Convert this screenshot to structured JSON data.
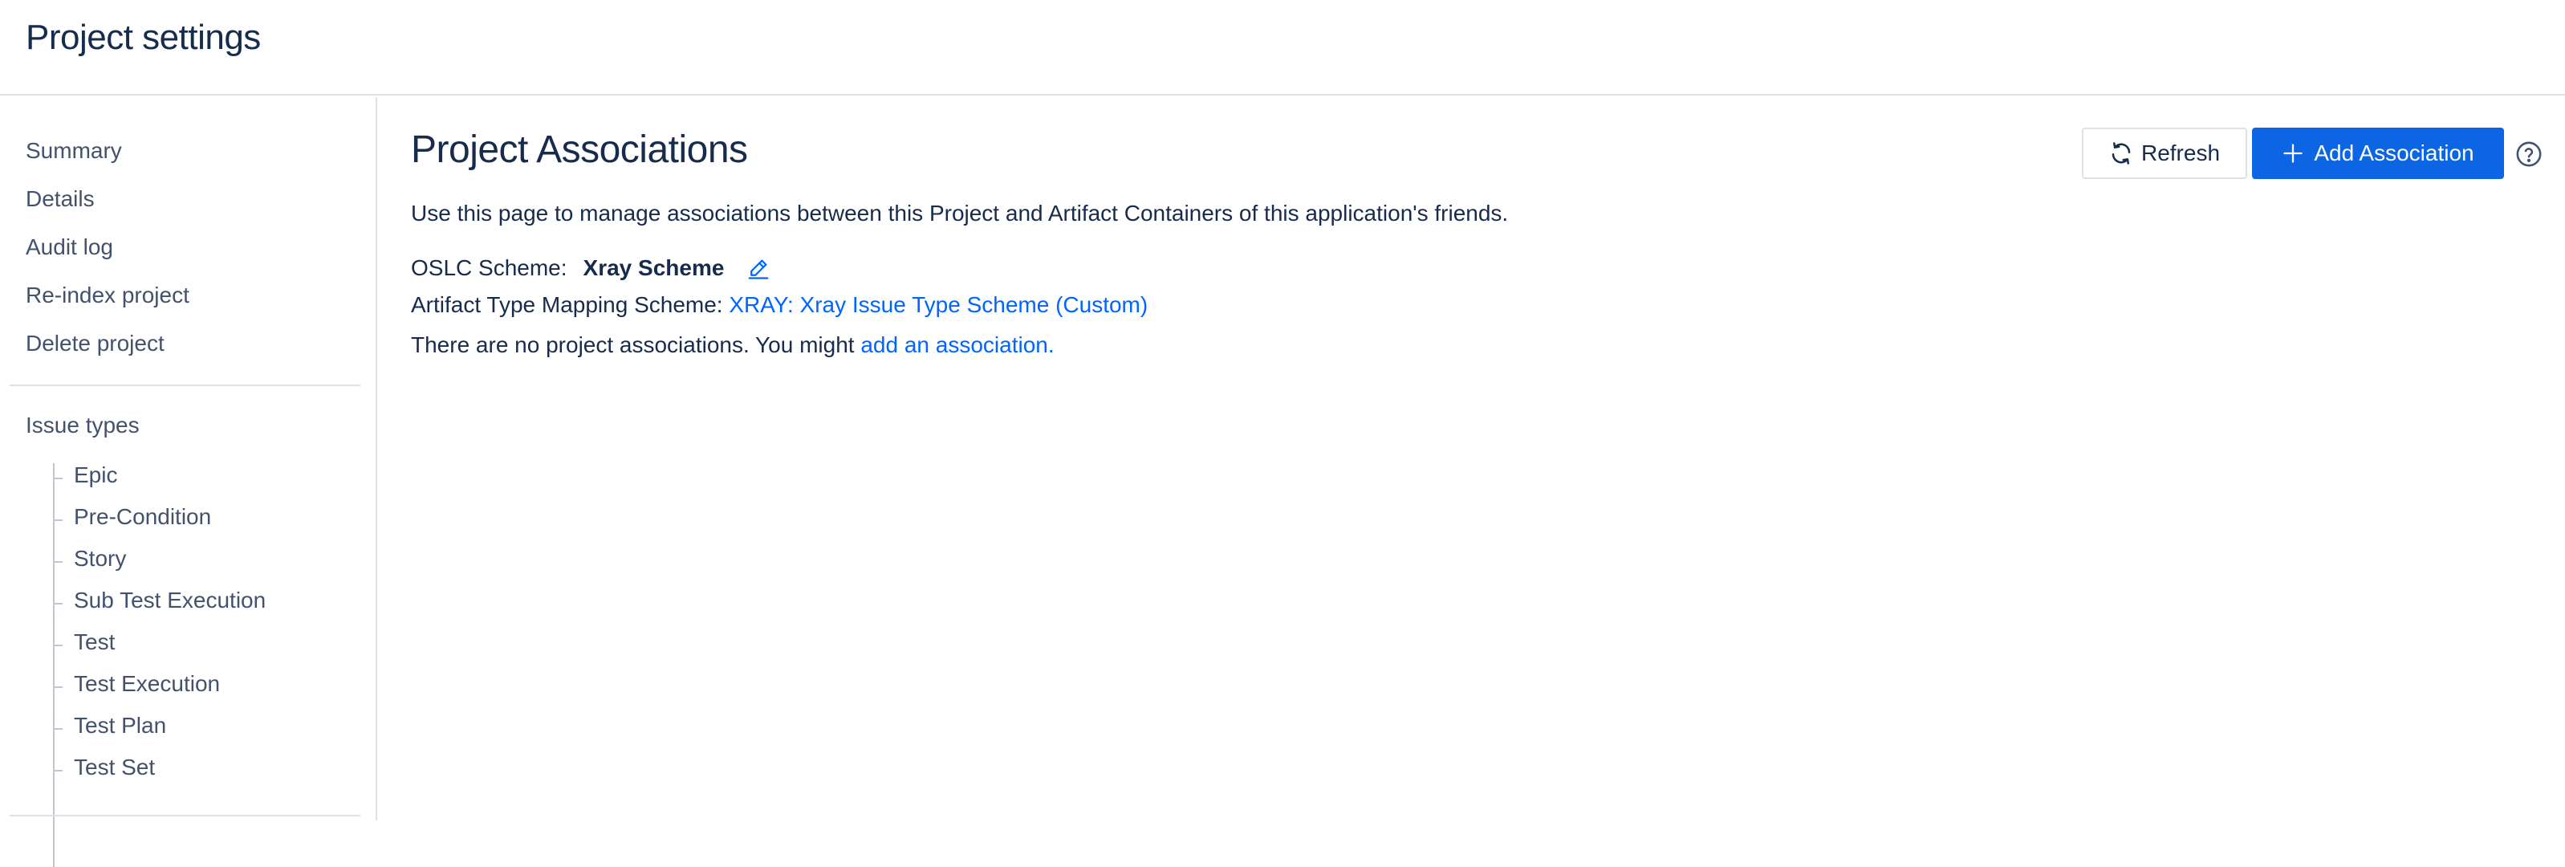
{
  "header": {
    "title": "Project settings"
  },
  "sidebar": {
    "items": [
      {
        "label": "Summary"
      },
      {
        "label": "Details"
      },
      {
        "label": "Audit log"
      },
      {
        "label": "Re-index project"
      },
      {
        "label": "Delete project"
      }
    ],
    "issue_types": {
      "label": "Issue types",
      "children": [
        {
          "label": "Epic"
        },
        {
          "label": "Pre-Condition"
        },
        {
          "label": "Story"
        },
        {
          "label": "Sub Test Execution"
        },
        {
          "label": "Test"
        },
        {
          "label": "Test Execution"
        },
        {
          "label": "Test Plan"
        },
        {
          "label": "Test Set"
        }
      ]
    }
  },
  "main": {
    "title": "Project Associations",
    "description": "Use this page to manage associations between this Project and Artifact Containers of this application's friends.",
    "oslc": {
      "label": "OSLC Scheme:",
      "value": "Xray Scheme"
    },
    "mapping": {
      "label": "Artifact Type Mapping Scheme:",
      "link": "XRAY: Xray Issue Type Scheme (Custom)"
    },
    "empty": {
      "text": "There are no project associations. You might",
      "link": "add an association."
    },
    "buttons": {
      "refresh": "Refresh",
      "add": "Add Association"
    }
  },
  "colors": {
    "primary": "#0c66e4",
    "link": "#0065ff",
    "text": "#172b4d",
    "nav_text": "#42526e",
    "border": "#dfe1e6"
  },
  "icons": {
    "refresh": "refresh-icon",
    "add": "plus-icon",
    "edit": "pencil-icon",
    "help": "help-icon"
  }
}
